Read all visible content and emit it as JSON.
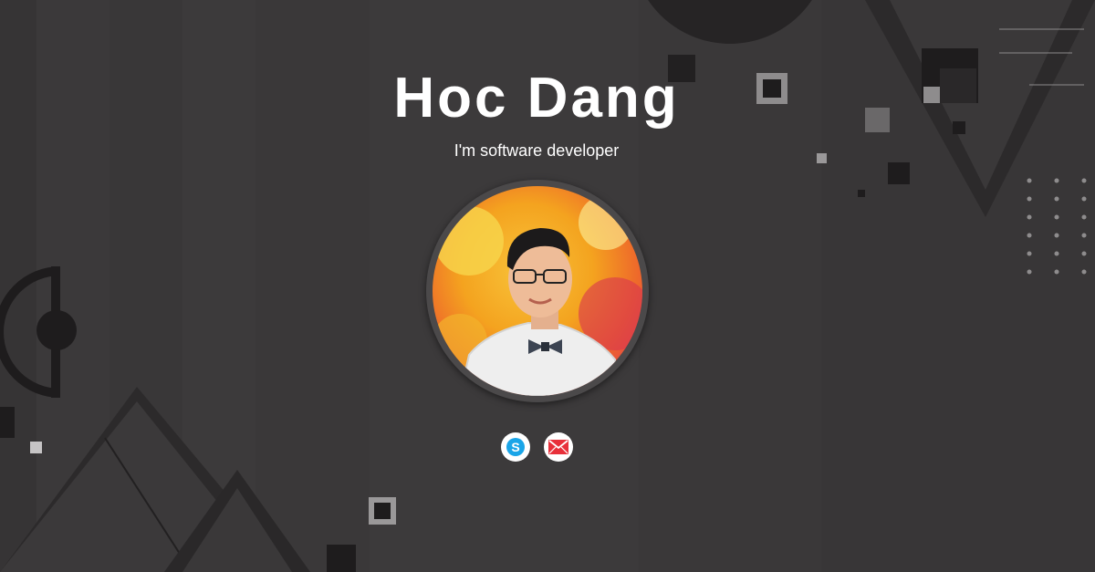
{
  "profile": {
    "name": "Hoc Dang",
    "tagline": "I'm software developer"
  },
  "social": [
    {
      "icon": "skype-icon",
      "color": "#1aa5e8"
    },
    {
      "icon": "mail-icon",
      "color": "#e8303a"
    }
  ],
  "colors": {
    "background": "#3a3839",
    "text": "#ffffff",
    "avatar_ring": "#4b494a"
  }
}
